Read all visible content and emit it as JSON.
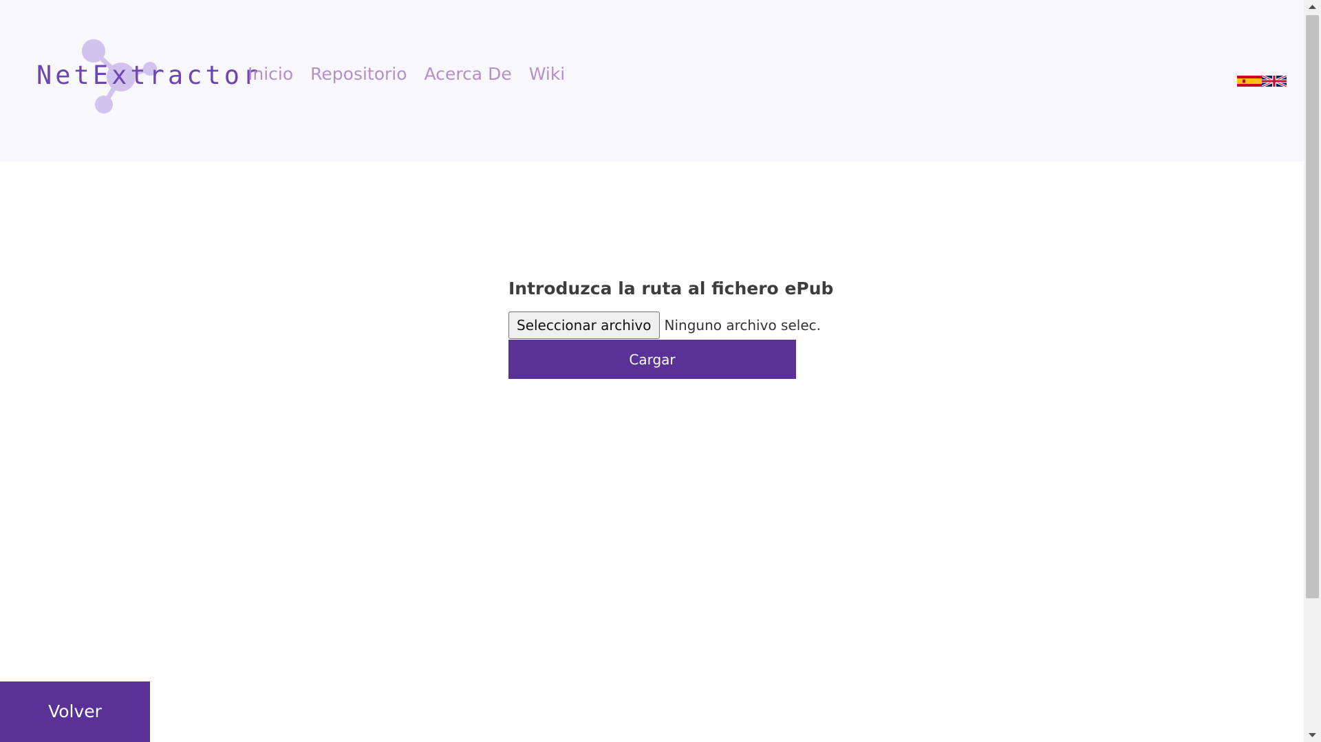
{
  "app": {
    "logo_text": "NetExtractor"
  },
  "nav": {
    "items": [
      {
        "label": "Inicio"
      },
      {
        "label": "Repositorio"
      },
      {
        "label": "Acerca De"
      },
      {
        "label": "Wiki"
      }
    ]
  },
  "languages": {
    "items": [
      {
        "code": "es",
        "icon": "spanish-flag-icon"
      },
      {
        "code": "en",
        "icon": "uk-flag-icon"
      }
    ]
  },
  "form": {
    "label": "Introduzca la ruta al fichero ePub",
    "file_button_label": "Seleccionar archivo",
    "file_status": "Ninguno archivo selec.",
    "submit_label": "Cargar"
  },
  "footer": {
    "back_label": "Volver"
  },
  "colors": {
    "primary": "#5a3297",
    "nav_link": "#b58fc9",
    "header_bg": "#f8f7fc",
    "logo_text": "#6a45b4",
    "logo_shape": "#d2c2ee"
  }
}
